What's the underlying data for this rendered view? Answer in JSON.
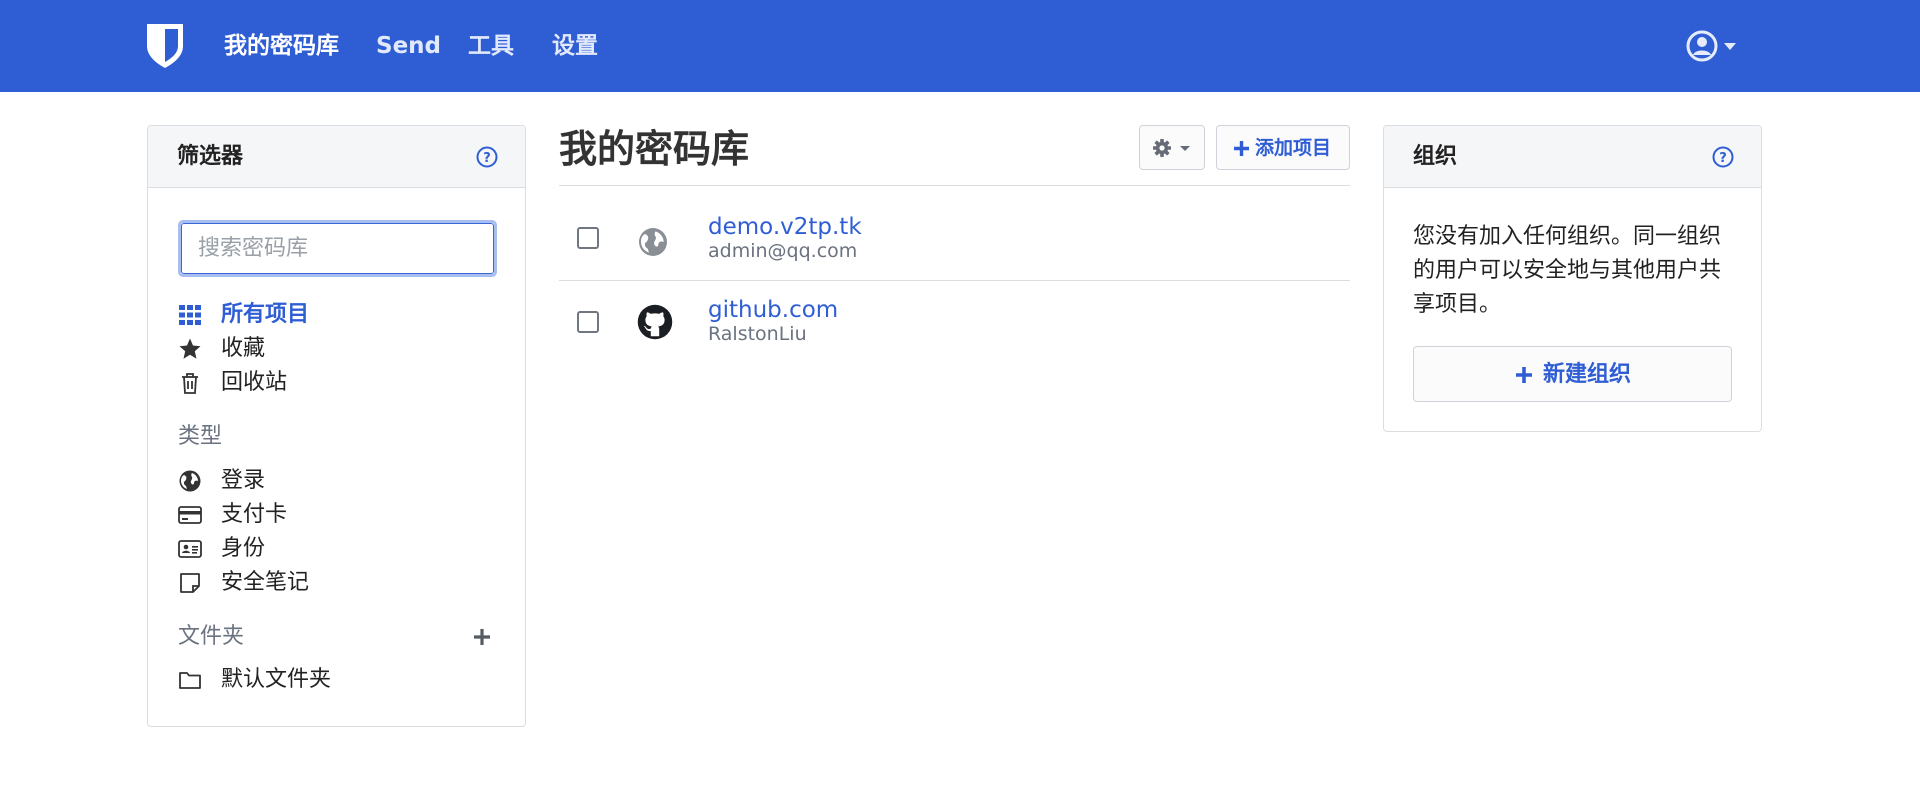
{
  "header": {
    "nav": [
      {
        "label": "我的密码库",
        "active": true
      },
      {
        "label": "Send",
        "active": false
      },
      {
        "label": "工具",
        "active": false
      },
      {
        "label": "设置",
        "active": false
      }
    ]
  },
  "filters": {
    "title": "筛选器",
    "search_placeholder": "搜索密码库",
    "items": [
      {
        "label": "所有项目",
        "icon": "grid-icon",
        "active": true
      },
      {
        "label": "收藏",
        "icon": "star-icon"
      },
      {
        "label": "回收站",
        "icon": "trash-icon"
      }
    ],
    "types_heading": "类型",
    "types": [
      {
        "label": "登录",
        "icon": "globe-icon"
      },
      {
        "label": "支付卡",
        "icon": "credit-card-icon"
      },
      {
        "label": "身份",
        "icon": "id-card-icon"
      },
      {
        "label": "安全笔记",
        "icon": "note-icon"
      }
    ],
    "folders_heading": "文件夹",
    "folders": [
      {
        "label": "默认文件夹",
        "icon": "folder-icon"
      }
    ]
  },
  "vault": {
    "title": "我的密码库",
    "add_item_label": "添加项目",
    "items": [
      {
        "name": "demo.v2tp.tk",
        "subtitle": "admin@qq.com",
        "icon": "globe-icon"
      },
      {
        "name": "github.com",
        "subtitle": "RalstonLiu",
        "icon": "github-icon"
      }
    ]
  },
  "organizations": {
    "title": "组织",
    "description": "您没有加入任何组织。同一组织的用户可以安全地与其他用户共享项目。",
    "new_org_label": "新建组织"
  },
  "colors": {
    "brand": "#2f5ed4",
    "link": "#2f5ed4"
  }
}
